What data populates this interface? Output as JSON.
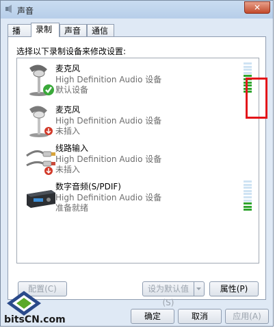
{
  "window": {
    "title": "声音",
    "close_label": "✕"
  },
  "tabs": [
    {
      "label": "播放",
      "active": false
    },
    {
      "label": "录制",
      "active": true
    },
    {
      "label": "声音",
      "active": false
    },
    {
      "label": "通信",
      "active": false
    }
  ],
  "instruction": "选择以下录制设备来修改设置:",
  "devices": [
    {
      "name": "麦克风",
      "driver": "High Definition Audio 设备",
      "status": "默认设备",
      "icon": "microphone-default-icon",
      "level_fraction": 0.55
    },
    {
      "name": "麦克风",
      "driver": "High Definition Audio 设备",
      "status": "未插入",
      "icon": "microphone-unplugged-icon"
    },
    {
      "name": "线路输入",
      "driver": "High Definition Audio 设备",
      "status": "未插入",
      "icon": "line-in-unplugged-icon"
    },
    {
      "name": "数字音频(S/PDIF)",
      "driver": "High Definition Audio 设备",
      "status": "准备就绪",
      "icon": "spdif-device-icon",
      "level_fraction": 0.3
    }
  ],
  "buttons": {
    "configure": "配置(C)",
    "set_default": "设为默认值(S)",
    "properties": "属性(P)",
    "ok": "确定",
    "cancel": "取消",
    "apply": "应用(A)"
  },
  "watermark": {
    "text": "bitsCN.com"
  },
  "colors": {
    "level_on": "#2fa52f",
    "level_off": "#cfe3f3",
    "highlight": "#e3151a",
    "check": "#3aa93a",
    "unplugged": "#d23a2a"
  }
}
